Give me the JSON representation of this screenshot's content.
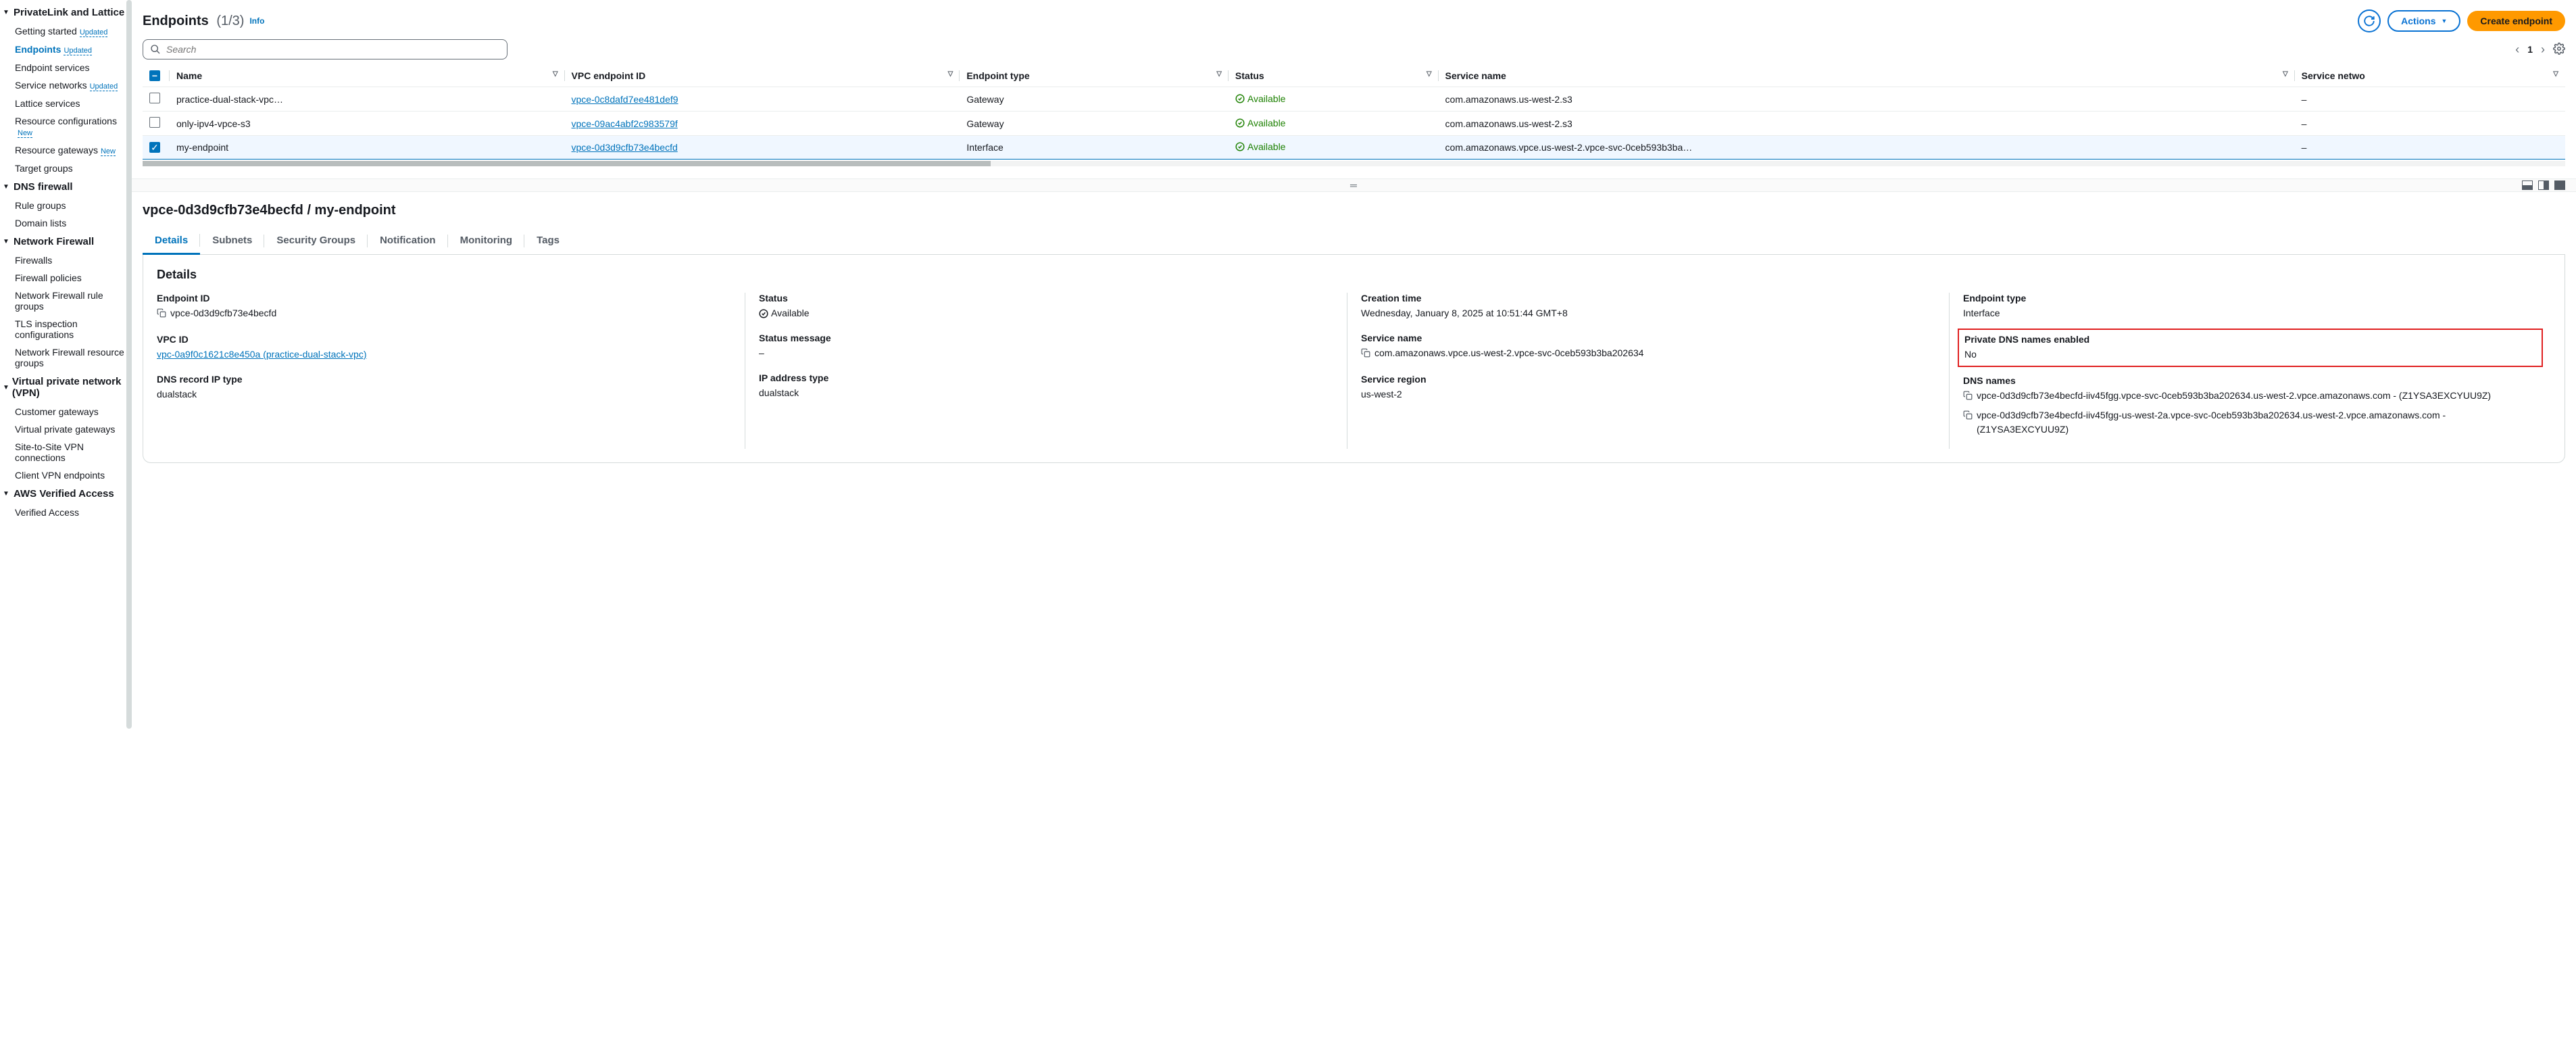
{
  "sidebar": {
    "sections": [
      {
        "title": "PrivateLink and Lattice",
        "items": [
          {
            "label": "Getting started",
            "badge": "Updated",
            "active": false
          },
          {
            "label": "Endpoints",
            "badge": "Updated",
            "active": true
          },
          {
            "label": "Endpoint services",
            "badge": "",
            "active": false
          },
          {
            "label": "Service networks",
            "badge": "Updated",
            "active": false
          },
          {
            "label": "Lattice services",
            "badge": "",
            "active": false
          },
          {
            "label": "Resource configurations",
            "badge": "New",
            "active": false
          },
          {
            "label": "Resource gateways",
            "badge": "New",
            "active": false
          },
          {
            "label": "Target groups",
            "badge": "",
            "active": false
          }
        ]
      },
      {
        "title": "DNS firewall",
        "items": [
          {
            "label": "Rule groups",
            "badge": "",
            "active": false
          },
          {
            "label": "Domain lists",
            "badge": "",
            "active": false
          }
        ]
      },
      {
        "title": "Network Firewall",
        "items": [
          {
            "label": "Firewalls",
            "badge": "",
            "active": false
          },
          {
            "label": "Firewall policies",
            "badge": "",
            "active": false
          },
          {
            "label": "Network Firewall rule groups",
            "badge": "",
            "active": false
          },
          {
            "label": "TLS inspection configurations",
            "badge": "",
            "active": false
          },
          {
            "label": "Network Firewall resource groups",
            "badge": "",
            "active": false
          }
        ]
      },
      {
        "title": "Virtual private network (VPN)",
        "items": [
          {
            "label": "Customer gateways",
            "badge": "",
            "active": false
          },
          {
            "label": "Virtual private gateways",
            "badge": "",
            "active": false
          },
          {
            "label": "Site-to-Site VPN connections",
            "badge": "",
            "active": false
          },
          {
            "label": "Client VPN endpoints",
            "badge": "",
            "active": false
          }
        ]
      },
      {
        "title": "AWS Verified Access",
        "items": [
          {
            "label": "Verified Access",
            "badge": "",
            "active": false
          }
        ]
      }
    ]
  },
  "header": {
    "title": "Endpoints",
    "count": "(1/3)",
    "info_label": "Info",
    "actions_label": "Actions",
    "create_label": "Create endpoint"
  },
  "search": {
    "placeholder": "Search"
  },
  "pager": {
    "page": "1"
  },
  "columns": [
    "Name",
    "VPC endpoint ID",
    "Endpoint type",
    "Status",
    "Service name",
    "Service netwo"
  ],
  "rows": [
    {
      "selected": false,
      "name": "practice-dual-stack-vpc…",
      "vpce": "vpce-0c8dafd7ee481def9",
      "type": "Gateway",
      "status": "Available",
      "service": "com.amazonaws.us-west-2.s3",
      "netwo": "–"
    },
    {
      "selected": false,
      "name": "only-ipv4-vpce-s3",
      "vpce": "vpce-09ac4abf2c983579f",
      "type": "Gateway",
      "status": "Available",
      "service": "com.amazonaws.us-west-2.s3",
      "netwo": "–"
    },
    {
      "selected": true,
      "name": "my-endpoint",
      "vpce": "vpce-0d3d9cfb73e4becfd",
      "type": "Interface",
      "status": "Available",
      "service": "com.amazonaws.vpce.us-west-2.vpce-svc-0ceb593b3ba…",
      "netwo": "–"
    }
  ],
  "detail": {
    "heading": "vpce-0d3d9cfb73e4becfd / my-endpoint",
    "tabs": [
      "Details",
      "Subnets",
      "Security Groups",
      "Notification",
      "Monitoring",
      "Tags"
    ],
    "active_tab": 0,
    "panel_title": "Details",
    "fields": {
      "endpoint_id_label": "Endpoint ID",
      "endpoint_id": "vpce-0d3d9cfb73e4becfd",
      "vpc_id_label": "VPC ID",
      "vpc_id": "vpc-0a9f0c1621c8e450a (practice-dual-stack-vpc)",
      "dns_record_type_label": "DNS record IP type",
      "dns_record_type": "dualstack",
      "status_label": "Status",
      "status": "Available",
      "status_msg_label": "Status message",
      "status_msg": "–",
      "ip_type_label": "IP address type",
      "ip_type": "dualstack",
      "creation_label": "Creation time",
      "creation": "Wednesday, January 8, 2025 at 10:51:44 GMT+8",
      "service_name_label": "Service name",
      "service_name": "com.amazonaws.vpce.us-west-2.vpce-svc-0ceb593b3ba202634",
      "region_label": "Service region",
      "region": "us-west-2",
      "endpoint_type_label": "Endpoint type",
      "endpoint_type": "Interface",
      "private_dns_label": "Private DNS names enabled",
      "private_dns": "No",
      "dns_names_label": "DNS names",
      "dns_name_1": "vpce-0d3d9cfb73e4becfd-iiv45fgg.vpce-svc-0ceb593b3ba202634.us-west-2.vpce.amazonaws.com - (Z1YSA3EXCYUU9Z)",
      "dns_name_2": "vpce-0d3d9cfb73e4becfd-iiv45fgg-us-west-2a.vpce-svc-0ceb593b3ba202634.us-west-2.vpce.amazonaws.com - (Z1YSA3EXCYUU9Z)"
    }
  }
}
